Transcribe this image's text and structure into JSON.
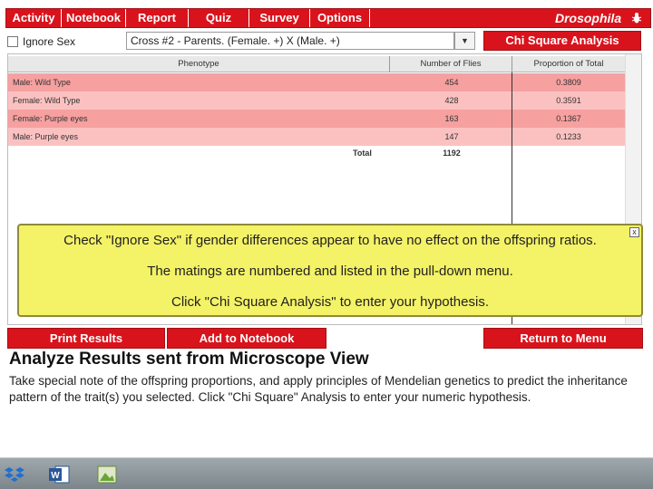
{
  "menu": {
    "items": [
      "Activity",
      "Notebook",
      "Report",
      "Quiz",
      "Survey",
      "Options"
    ],
    "brand": "Drosophila",
    "brand_color": "#d9131c"
  },
  "controls": {
    "ignore_sex_label": "Ignore Sex",
    "ignore_sex_checked": false,
    "cross_select_value": "Cross #2 - Parents. (Female. +) X (Male. +)",
    "chi_button": "Chi Square Analysis"
  },
  "table": {
    "headers": [
      "Phenotype",
      "Number of Flies",
      "Proportion of Total"
    ],
    "rows": [
      {
        "phenotype": "Male: Wild Type",
        "count": "454",
        "proportion": "0.3809"
      },
      {
        "phenotype": "Female: Wild Type",
        "count": "428",
        "proportion": "0.3591"
      },
      {
        "phenotype": "Female: Purple eyes",
        "count": "163",
        "proportion": "0.1367"
      },
      {
        "phenotype": "Male: Purple eyes",
        "count": "147",
        "proportion": "0.1233"
      }
    ],
    "total_label": "Total",
    "total_value": "1192",
    "row_colors": [
      "#f6a0a0",
      "#fbc1c1"
    ]
  },
  "popup": {
    "close": "x",
    "lines": [
      "Check \"Ignore Sex\" if gender differences appear to have no effect on the offspring ratios.",
      "The matings are numbered and listed in the pull-down menu.",
      "Click \"Chi Square Analysis\" to enter your hypothesis."
    ],
    "background": "#f4f266"
  },
  "bottom_buttons": {
    "print": "Print Results",
    "add_notebook": "Add to Notebook",
    "return_menu": "Return to Menu"
  },
  "instructions": {
    "heading": "Analyze Results sent from Microscope View",
    "body": "Take special note of the offspring proportions, and apply principles of Mendelian genetics to predict the inheritance pattern of the trait(s) you selected. Click \"Chi Square\" Analysis to enter your numeric hypothesis."
  },
  "taskbar": {
    "icons": [
      "dropbox-icon",
      "word-icon",
      "image-viewer-icon"
    ]
  }
}
